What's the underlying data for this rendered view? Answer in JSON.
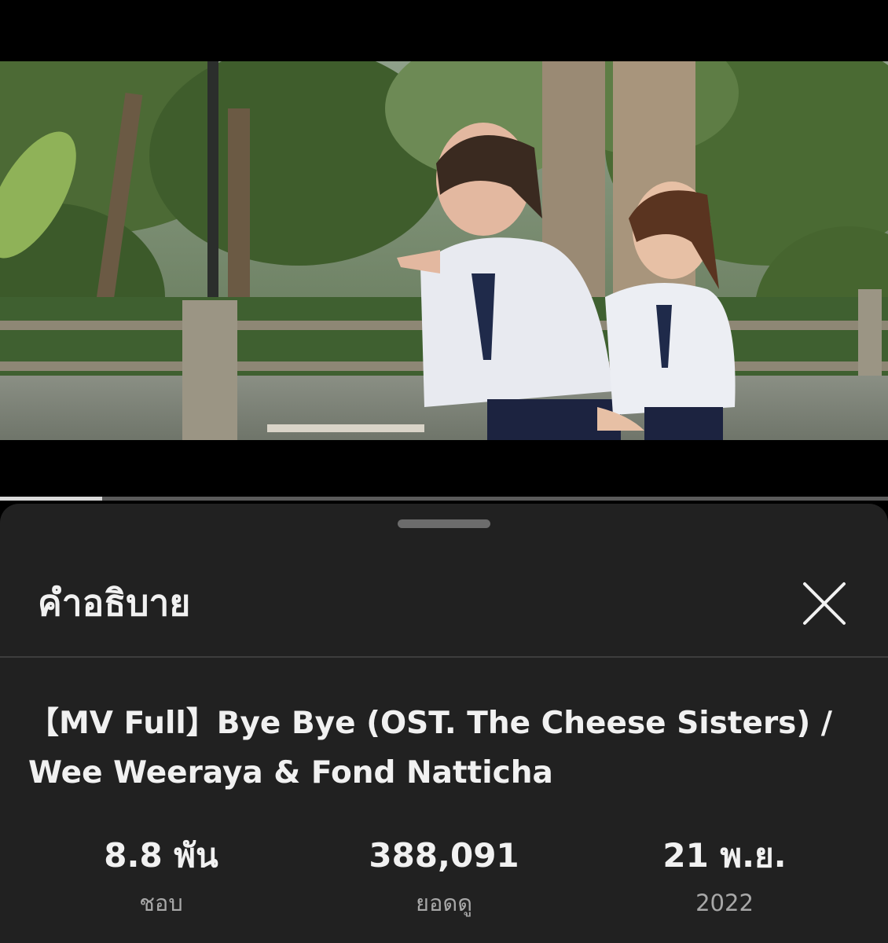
{
  "player": {
    "progress_fraction": 0.115
  },
  "description_sheet": {
    "title": "คำอธิบาย",
    "close_icon": "close-icon"
  },
  "video": {
    "title": "【MV Full】Bye Bye (OST. The Cheese Sisters) / Wee Weeraya & Fond Natticha"
  },
  "stats": {
    "likes": {
      "value": "8.8 พัน",
      "label": "ชอบ"
    },
    "views": {
      "value": "388,091",
      "label": "ยอดดู"
    },
    "date": {
      "value": "21 พ.ย.",
      "label": "2022"
    }
  }
}
